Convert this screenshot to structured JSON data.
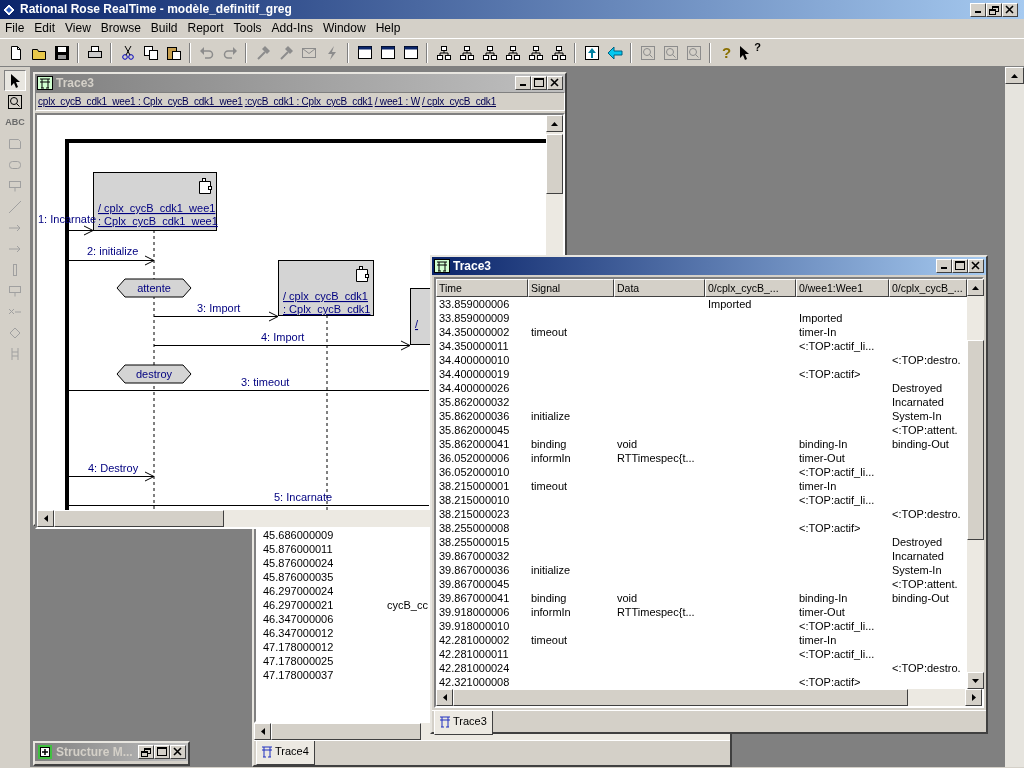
{
  "app": {
    "title": "Rational Rose RealTime - modèle_definitif_greg"
  },
  "menu": [
    "File",
    "Edit",
    "View",
    "Browse",
    "Build",
    "Report",
    "Tools",
    "Add-Ins",
    "Window",
    "Help"
  ],
  "toolbar": [
    {
      "kind": "new",
      "disabled": false
    },
    {
      "kind": "open",
      "disabled": false
    },
    {
      "kind": "save",
      "disabled": false
    },
    {
      "kind": "separator"
    },
    {
      "kind": "print",
      "disabled": false
    },
    {
      "kind": "separator"
    },
    {
      "kind": "cut",
      "disabled": false
    },
    {
      "kind": "copy",
      "disabled": false
    },
    {
      "kind": "paste",
      "disabled": false
    },
    {
      "kind": "separator"
    },
    {
      "kind": "undo",
      "disabled": true
    },
    {
      "kind": "redo",
      "disabled": true
    },
    {
      "kind": "separator"
    },
    {
      "kind": "hammer",
      "disabled": true
    },
    {
      "kind": "hammer",
      "disabled": true
    },
    {
      "kind": "envelope",
      "disabled": true
    },
    {
      "kind": "bolt",
      "disabled": true
    },
    {
      "kind": "separator"
    },
    {
      "kind": "window",
      "disabled": false
    },
    {
      "kind": "window",
      "disabled": false
    },
    {
      "kind": "window",
      "disabled": false
    },
    {
      "kind": "separator"
    },
    {
      "kind": "hierarchy",
      "disabled": false
    },
    {
      "kind": "hierarchy",
      "disabled": false
    },
    {
      "kind": "hierarchy",
      "disabled": false
    },
    {
      "kind": "hierarchy",
      "disabled": false
    },
    {
      "kind": "hierarchy",
      "disabled": false
    },
    {
      "kind": "hierarchy",
      "disabled": false
    },
    {
      "kind": "separator"
    },
    {
      "kind": "upload",
      "disabled": false
    },
    {
      "kind": "back",
      "disabled": false
    },
    {
      "kind": "separator"
    },
    {
      "kind": "zoom",
      "disabled": true
    },
    {
      "kind": "zoom",
      "disabled": true
    },
    {
      "kind": "zoom",
      "disabled": true
    },
    {
      "kind": "separator"
    },
    {
      "kind": "help",
      "glyph": "?",
      "disabled": false
    },
    {
      "kind": "whatsthis",
      "glyph": "?",
      "disabled": false
    }
  ],
  "palette": [
    {
      "kind": "pointer",
      "disabled": false
    },
    {
      "kind": "zoom",
      "disabled": false
    },
    {
      "kind": "text",
      "glyph": "ABC",
      "disabled": true
    },
    {
      "kind": "note",
      "disabled": true
    },
    {
      "kind": "state",
      "disabled": true
    },
    {
      "kind": "capsule",
      "disabled": true
    },
    {
      "kind": "line",
      "disabled": true
    },
    {
      "kind": "arrow",
      "disabled": true
    },
    {
      "kind": "arrow",
      "disabled": true
    },
    {
      "kind": "bar",
      "disabled": true
    },
    {
      "kind": "capsule",
      "disabled": true
    },
    {
      "kind": "cross",
      "disabled": true
    },
    {
      "kind": "diamond",
      "disabled": true
    },
    {
      "kind": "ladder",
      "disabled": true
    }
  ],
  "diagram_window": {
    "title": "Trace3",
    "active": false,
    "instances": [
      "cplx_cycB_cdk1_wee1 : Cplx_cycB_cdk1_wee1",
      ":cycB_cdk1 : Cplx_cycB_cdk1",
      "/ wee1 : W",
      "/ cplx_cycB_cdk1"
    ],
    "objects": [
      {
        "line1": "/ cplx_cycB_cdk1_wee1",
        "line2": ": Cplx_cycB_cdk1_wee1"
      },
      {
        "line1": "/ cplx_cycB_cdk1",
        "line2": ": Cplx_cycB_cdk1"
      },
      {
        "line1": "/"
      }
    ],
    "states": [
      "attente",
      "destroy"
    ],
    "messages": [
      "1: Incarnate",
      "2: initialize",
      "3: Import",
      "4: Import",
      "3: timeout",
      "4: Destroy",
      "5: Incarnate"
    ]
  },
  "trace_window": {
    "title": "Trace3",
    "active": true,
    "columns": [
      "Time",
      "Signal",
      "Data",
      "0/cplx_cycB_...",
      "0/wee1:Wee1",
      "0/cplx_cycB_..."
    ],
    "rows": [
      {
        "time": "33.859000006",
        "column_4": "Imported"
      },
      {
        "time": "33.859000009",
        "column_5": "Imported"
      },
      {
        "time": "34.350000002",
        "signal": "timeout",
        "column_5": "timer-In"
      },
      {
        "time": "34.350000011",
        "column_5": "<:TOP:actif_li..."
      },
      {
        "time": "34.400000010",
        "column_6": "<:TOP:destro."
      },
      {
        "time": "34.400000019",
        "column_5": "<:TOP:actif>"
      },
      {
        "time": "34.400000026",
        "column_6": "Destroyed"
      },
      {
        "time": "35.862000032",
        "column_6": "Incarnated"
      },
      {
        "time": "35.862000036",
        "signal": "initialize",
        "column_6": "System-In"
      },
      {
        "time": "35.862000045",
        "column_6": "<:TOP:attent."
      },
      {
        "time": "35.862000041",
        "signal": "binding",
        "data": "void",
        "column_5": "binding-In",
        "column_6": "binding-Out"
      },
      {
        "time": "36.052000006",
        "signal": "informIn",
        "data": "RTTimespec{t...",
        "column_5": "timer-Out"
      },
      {
        "time": "36.052000010",
        "column_5": "<:TOP:actif_li..."
      },
      {
        "time": "38.215000001",
        "signal": "timeout",
        "column_5": "timer-In"
      },
      {
        "time": "38.215000010",
        "column_5": "<:TOP:actif_li..."
      },
      {
        "time": "38.215000023",
        "column_6": "<:TOP:destro."
      },
      {
        "time": "38.255000008",
        "column_5": "<:TOP:actif>"
      },
      {
        "time": "38.255000015",
        "column_6": "Destroyed"
      },
      {
        "time": "39.867000032",
        "column_6": "Incarnated"
      },
      {
        "time": "39.867000036",
        "signal": "initialize",
        "column_6": "System-In"
      },
      {
        "time": "39.867000045",
        "column_6": "<:TOP:attent."
      },
      {
        "time": "39.867000041",
        "signal": "binding",
        "data": "void",
        "column_5": "binding-In",
        "column_6": "binding-Out"
      },
      {
        "time": "39.918000006",
        "signal": "informIn",
        "data": "RTTimespec{t...",
        "column_5": "timer-Out"
      },
      {
        "time": "39.918000010",
        "column_5": "<:TOP:actif_li..."
      },
      {
        "time": "42.281000002",
        "signal": "timeout",
        "column_5": "timer-In"
      },
      {
        "time": "42.281000011",
        "column_5": "<:TOP:actif_li..."
      },
      {
        "time": "42.281000024",
        "column_6": "<:TOP:destro."
      },
      {
        "time": "42.321000008",
        "column_5": "<:TOP:actif>"
      }
    ],
    "tabs": [
      {
        "label": "Trace3",
        "selected": true
      }
    ]
  },
  "trace4_window": {
    "rows": [
      {
        "time": "45.686000009"
      },
      {
        "time": "45.876000011"
      },
      {
        "time": "45.876000024"
      },
      {
        "time": "45.876000035"
      },
      {
        "time": "46.297000024"
      },
      {
        "time": "46.297000021",
        "column_2": "cycB_cc"
      },
      {
        "time": "46.347000006"
      },
      {
        "time": "46.347000012"
      },
      {
        "time": "47.178000012"
      },
      {
        "time": "47.178000025"
      },
      {
        "time": "47.178000037"
      }
    ],
    "tabs": [
      {
        "label": "Trace4",
        "selected": true
      }
    ]
  },
  "minimized_window": {
    "title": "Structure M...",
    "active": false
  }
}
